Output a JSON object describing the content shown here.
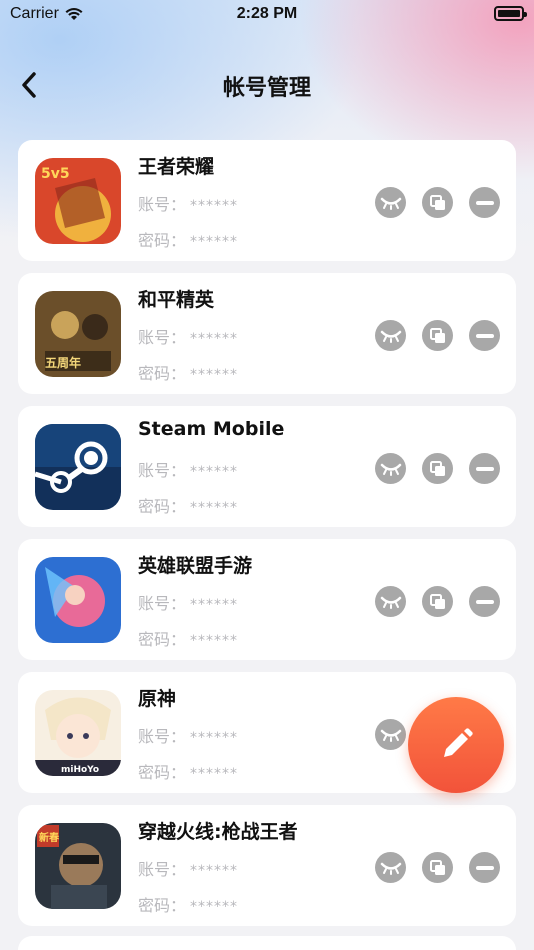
{
  "status_bar": {
    "carrier": "Carrier",
    "time": "2:28 PM"
  },
  "nav": {
    "title": "帐号管理",
    "back_icon": "chevron-left-icon"
  },
  "accounts": [
    {
      "name": "王者荣耀",
      "account_label": "账号：",
      "account_value": "******",
      "password_label": "密码：",
      "password_value": "******",
      "icon_colors": [
        "#d94a2a",
        "#f2c14b"
      ]
    },
    {
      "name": "和平精英",
      "account_label": "账号：",
      "account_value": "******",
      "password_label": "密码：",
      "password_value": "******",
      "icon_colors": [
        "#7a5a2f",
        "#c9a35a"
      ]
    },
    {
      "name": "Steam Mobile",
      "account_label": "账号：",
      "account_value": "******",
      "password_label": "密码：",
      "password_value": "******",
      "icon_colors": [
        "#10274a",
        "#1b5c9c"
      ]
    },
    {
      "name": "英雄联盟手游",
      "account_label": "账号：",
      "account_value": "******",
      "password_label": "密码：",
      "password_value": "******",
      "icon_colors": [
        "#2a6fd1",
        "#e65a8c"
      ]
    },
    {
      "name": "原神",
      "account_label": "账号：",
      "account_value": "******",
      "password_label": "密码：",
      "password_value": "******",
      "icon_colors": [
        "#f4ece0",
        "#3a3a5a"
      ]
    },
    {
      "name": "穿越火线:枪战王者",
      "account_label": "账号：",
      "account_value": "******",
      "password_label": "密码：",
      "password_value": "******",
      "icon_colors": [
        "#26303a",
        "#8a6a3a"
      ]
    }
  ],
  "action_icons": [
    "eye-closed-icon",
    "copy-icon",
    "remove-icon"
  ],
  "fab_icon": "pencil-icon",
  "colors": {
    "accent": "#f2533a",
    "action_bg": "#a8a8a8",
    "label_gray": "#b8b8bc"
  }
}
